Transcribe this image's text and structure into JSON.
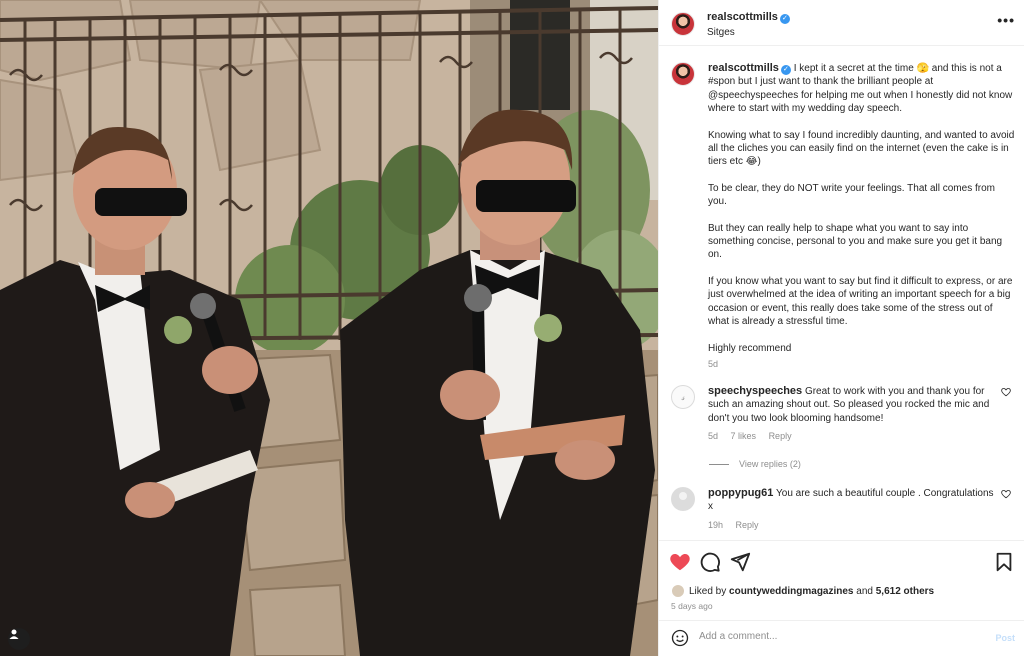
{
  "post": {
    "username": "realscottmills",
    "verified_glyph": "✓",
    "location": "Sitges",
    "more_label": "•••"
  },
  "caption": {
    "username": "realscottmills",
    "paragraphs": [
      "I kept it a secret at the time 🫣 and this is not a #spon but I just want to thank the brilliant people at @speechyspeeches for helping me out when I honestly did not know where to start with my wedding day speech.",
      "Knowing what to say I found incredibly daunting, and wanted to avoid all the cliches you can easily find on the internet (even the cake is in tiers etc 😂)",
      "To be clear, they do NOT write your feelings. That all comes from you.",
      "But they can really help to shape what you want to say into something concise, personal to you and make sure you get it bang on.",
      "If you know what you want to say but find it difficult to express, or are just overwhelmed at the idea of writing an important speech for a big occasion or event, this really does take some of the stress out of what is already a stressful time.",
      "Highly recommend"
    ],
    "time": "5d"
  },
  "comments": [
    {
      "username": "speechyspeeches",
      "text": "Great to work with you and thank you for such an amazing shout out. So pleased you rocked the mic and don't you two look blooming handsome!",
      "time": "5d",
      "likes": "7 likes",
      "reply": "Reply",
      "view_replies": "View replies (2)"
    },
    {
      "username": "poppypug61",
      "text": "You are such a beautiful couple . Congratulations x",
      "time": "19h",
      "reply": "Reply"
    }
  ],
  "actions": {
    "liked_by_prefix": "Liked by",
    "liked_by_user": "countyweddingmagazines",
    "and": "and",
    "others": "5,612 others",
    "date": "5 days ago"
  },
  "add_comment": {
    "placeholder": "Add a comment...",
    "post_label": "Post"
  },
  "icons": {
    "heart": "heart-icon",
    "comment": "comment-icon",
    "share": "share-icon",
    "bookmark": "bookmark-icon",
    "emoji": "emoji-icon",
    "more": "more-icon"
  },
  "colors": {
    "like_red": "#ed4956",
    "verified_blue": "#3897f0",
    "secondary_text": "#8e8e8e",
    "post_disabled": "#c5dffa"
  }
}
